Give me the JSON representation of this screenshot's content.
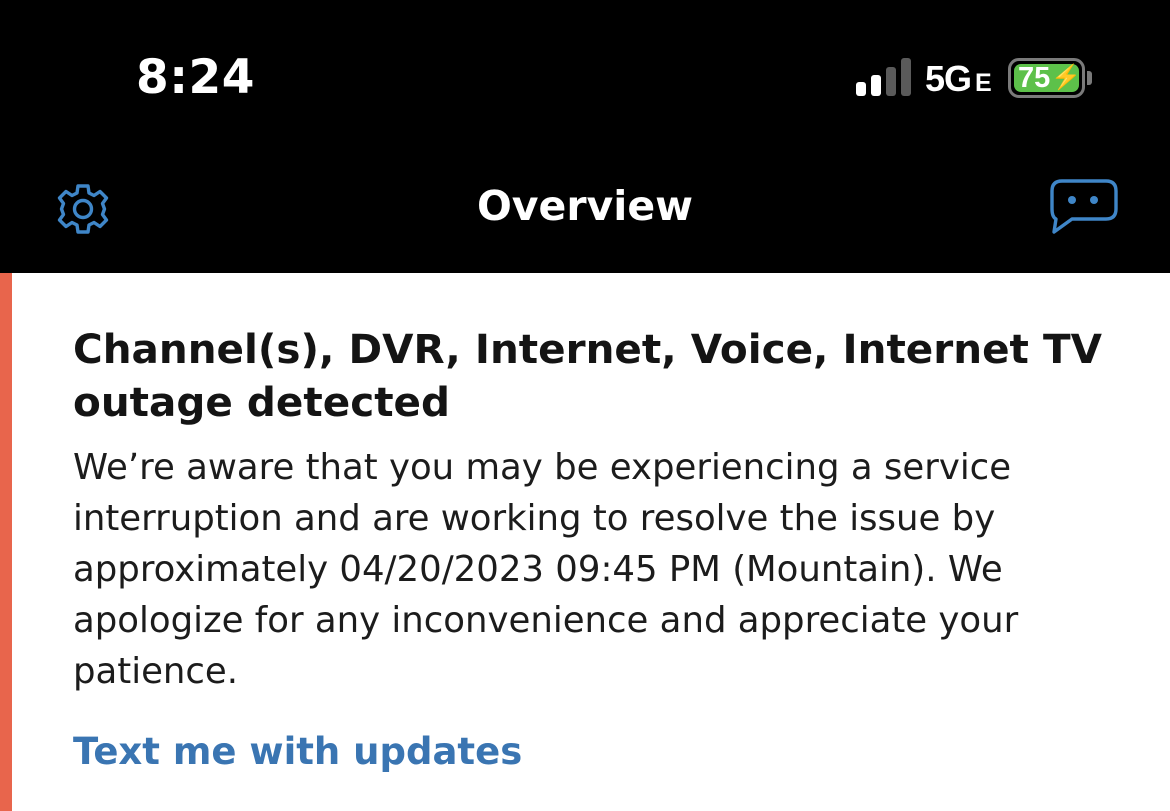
{
  "status_bar": {
    "time": "8:24",
    "network": "5G",
    "network_suffix": "E",
    "battery_percent": "75",
    "battery_level": 0.75,
    "charging": true,
    "signal_bars_active": 2,
    "signal_bars_total": 4
  },
  "nav": {
    "title": "Overview",
    "left_icon": "settings-gear-icon",
    "right_icon": "chat-bubble-icon",
    "icon_color": "#3f86c8"
  },
  "alert": {
    "title": "Channel(s), DVR, Internet, Voice, Internet TV outage detected",
    "body": "We’re aware that you may be experiencing a service interruption and are working to resolve the issue by approximately 04/20/2023 09:45 PM (Mountain).  We apologize for any inconvenience and appreciate your patience.",
    "link_label": "Text me with updates",
    "accent_color": "#e8654c",
    "link_color": "#3a75b2"
  }
}
